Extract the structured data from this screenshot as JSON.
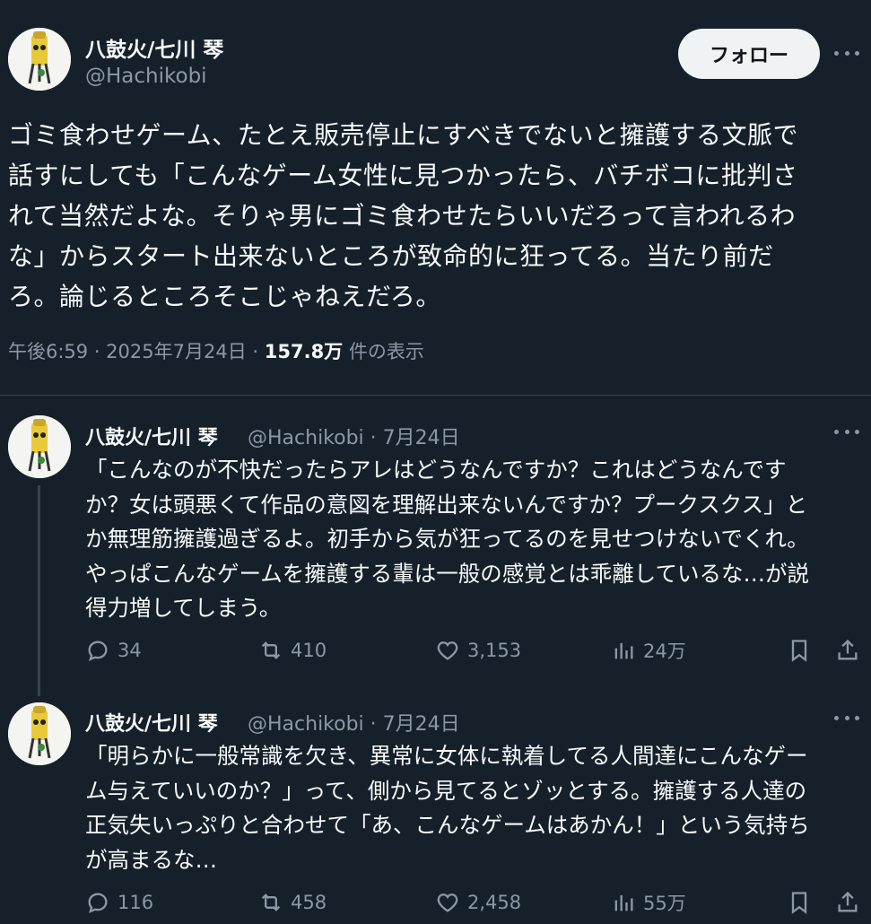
{
  "main": {
    "name": "八鼓火/七川 琴",
    "handle": "@Hachikobi",
    "follow_label": "フォロー",
    "text_lines": [
      "ゴミ食わせゲーム、たとえ販売停止にすべきでないと擁護する文脈で",
      "話すにしても「こんなゲーム女性に見つかったら、バチボコに批判さ",
      "れて当然だよな。そりゃ男にゴミ食わせたらいいだろって言われるわ",
      "な」からスタート出来ないところが致命的に狂ってる。当たり前だ",
      "ろ。論じるところそこじゃねえだろ。"
    ],
    "time": "午後6:59 · 2025年7月24日 · ",
    "views": "157.8万",
    "views_suffix": " 件の表示"
  },
  "replies": [
    {
      "name": "八鼓火/七川 琴",
      "handle_date": "@Hachikobi · 7月24日",
      "text_lines": [
        "「こんなのが不快だったらアレはどうなんですか？これはどうなんです",
        "か？女は頭悪くて作品の意図を理解出来ないんですか？プークスクス」と",
        "か無理筋擁護過ぎるよ。初手から気が狂ってるのを見せつけないでくれ。",
        "やっぱこんなゲームを擁護する輩は一般の感覚とは乖離しているな…が説",
        "得力増してしまう。"
      ],
      "replies": "34",
      "reposts": "410",
      "likes": "3,153",
      "views": "24万"
    },
    {
      "name": "八鼓火/七川 琴",
      "handle_date": "@Hachikobi · 7月24日",
      "text_lines": [
        "「明らかに一般常識を欠き、異常に女体に執着してる人間達にこんなゲー",
        "ム与えていいのか？」って、側から見てるとゾッとする。擁護する人達の",
        "正気失いっぷりと合わせて「あ、こんなゲームはあかん！」という気持ち",
        "が高まるな…"
      ],
      "replies": "116",
      "reposts": "458",
      "likes": "2,458",
      "views": "55万"
    }
  ],
  "colors": {
    "background": "#15202b",
    "text": "#f7f9f9",
    "secondary": "#8b98a5",
    "divider": "#38444d",
    "follow_bg": "#eff3f4"
  }
}
